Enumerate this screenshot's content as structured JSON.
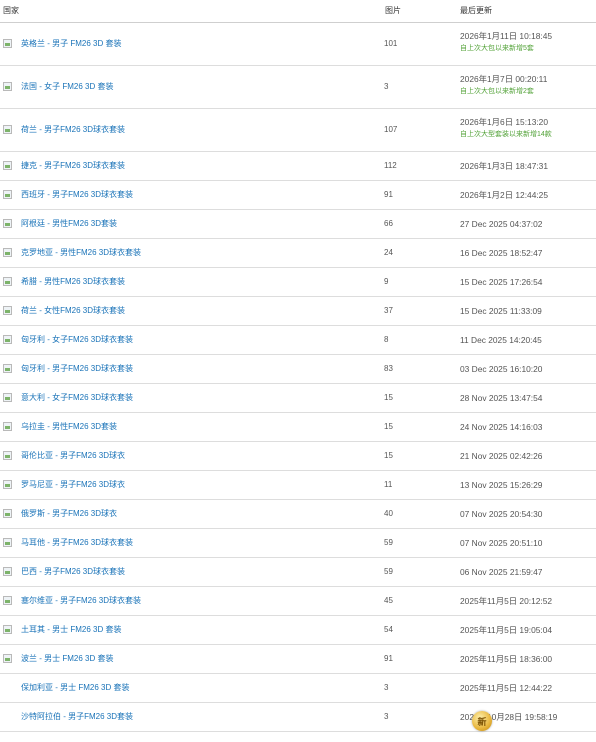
{
  "header": {
    "country": "国家",
    "images": "图片",
    "updated": "最后更新"
  },
  "rows": [
    {
      "name": "英格兰 - 男子 FM26 3D 套装",
      "count": "101",
      "date": "2026年1月11日 10:18:45",
      "note": "自上次大包以来新增5套",
      "thumb": true
    },
    {
      "name": "法国 - 女子 FM26 3D 套装",
      "count": "3",
      "date": "2026年1月7日 00:20:11",
      "note": "自上次大包以来新增2套",
      "thumb": true
    },
    {
      "name": "荷兰 - 男子FM26 3D球衣套装",
      "count": "107",
      "date": "2026年1月6日 15:13:20",
      "note": "自上次大型套装以来新增14款",
      "thumb": true
    },
    {
      "name": "捷克 - 男子FM26 3D球衣套装",
      "count": "112",
      "date": "2026年1月3日 18:47:31",
      "thumb": true
    },
    {
      "name": "西班牙 - 男子FM26 3D球衣套装",
      "count": "91",
      "date": "2026年1月2日 12:44:25",
      "thumb": true
    },
    {
      "name": "阿根廷 - 男性FM26 3D套装",
      "count": "66",
      "date": "27 Dec 2025 04:37:02",
      "thumb": true
    },
    {
      "name": "克罗地亚 - 男性FM26 3D球衣套装",
      "count": "24",
      "date": "16 Dec 2025 18:52:47",
      "thumb": true
    },
    {
      "name": "希腊 - 男性FM26 3D球衣套装",
      "count": "9",
      "date": "15 Dec 2025 17:26:54",
      "thumb": true
    },
    {
      "name": "荷兰 - 女性FM26 3D球衣套装",
      "count": "37",
      "date": "15 Dec 2025 11:33:09",
      "thumb": true
    },
    {
      "name": "匈牙利 - 女子FM26 3D球衣套装",
      "count": "8",
      "date": "11 Dec 2025 14:20:45",
      "thumb": true
    },
    {
      "name": "匈牙利 - 男子FM26 3D球衣套装",
      "count": "83",
      "date": "03 Dec 2025 16:10:20",
      "thumb": true
    },
    {
      "name": "意大利 - 女子FM26 3D球衣套装",
      "count": "15",
      "date": "28 Nov 2025 13:47:54",
      "thumb": true
    },
    {
      "name": "乌拉圭 - 男性FM26 3D套装",
      "count": "15",
      "date": "24 Nov 2025 14:16:03",
      "thumb": true
    },
    {
      "name": "哥伦比亚 - 男子FM26 3D球衣",
      "count": "15",
      "date": "21 Nov 2025 02:42:26",
      "thumb": true
    },
    {
      "name": "罗马尼亚 - 男子FM26 3D球衣",
      "count": "11",
      "date": "13 Nov 2025 15:26:29",
      "thumb": true
    },
    {
      "name": "俄罗斯 - 男子FM26 3D球衣",
      "count": "40",
      "date": "07 Nov 2025 20:54:30",
      "thumb": true
    },
    {
      "name": "马耳他 - 男子FM26 3D球衣套装",
      "count": "59",
      "date": "07 Nov 2025 20:51:10",
      "thumb": true
    },
    {
      "name": "巴西 - 男子FM26 3D球衣套装",
      "count": "59",
      "date": "06 Nov 2025 21:59:47",
      "thumb": true
    },
    {
      "name": "塞尔维亚 - 男子FM26 3D球衣套装",
      "count": "45",
      "date": "2025年11月5日 20:12:52",
      "thumb": true
    },
    {
      "name": "土耳其 - 男士 FM26 3D 套装",
      "count": "54",
      "date": "2025年11月5日 19:05:04",
      "thumb": true
    },
    {
      "name": "波兰 - 男士 FM26 3D 套装",
      "count": "91",
      "date": "2025年11月5日 18:36:00",
      "thumb": true
    },
    {
      "name": "保加利亚 - 男士 FM26 3D 套装",
      "count": "3",
      "date": "2025年11月5日 12:44:22",
      "thumb": false
    },
    {
      "name": "沙特阿拉伯 - 男子FM26 3D套装",
      "count": "3",
      "date": "2025年10月28日 19:58:19",
      "thumb": false
    }
  ],
  "badge": {
    "label": "新",
    "icon": "coin-badge-icon"
  }
}
